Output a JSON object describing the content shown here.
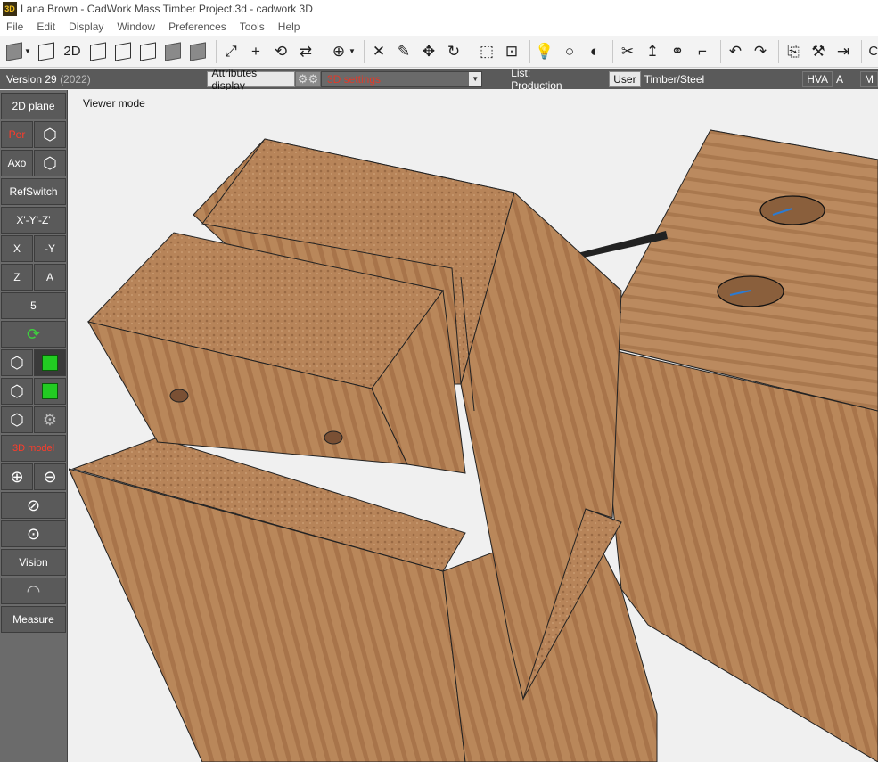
{
  "window": {
    "title": "Lana Brown - CadWork Mass Timber Project.3d - cadwork 3D",
    "app_icon": "3D"
  },
  "menu": [
    "File",
    "Edit",
    "Display",
    "Window",
    "Preferences",
    "Tools",
    "Help"
  ],
  "toolbar": {
    "label_2d": "2D",
    "clip_label": "CL"
  },
  "status": {
    "version": "Version 29",
    "year": "(2022)",
    "attributes_display": "Attributes display",
    "settings_3d": "3D settings",
    "list": "List: Production",
    "user_button": "User",
    "user_mode": "Timber/Steel",
    "hva": "HVA",
    "a": "A",
    "m": "M"
  },
  "sidebar": {
    "plane_2d": "2D plane",
    "per": "Per",
    "axo": "Axo",
    "refswitch": "RefSwitch",
    "xyz": "X'-Y'-Z'",
    "x": "X",
    "neg_y": "-Y",
    "z": "Z",
    "a": "A",
    "five": "5",
    "model_3d": "3D model",
    "vision": "Vision",
    "measure": "Measure"
  },
  "viewport": {
    "mode_label": "Viewer mode"
  },
  "colors": {
    "accent_red": "#e03a2a",
    "wood": "#b9875a",
    "panel_dark": "#5a5a5a"
  }
}
